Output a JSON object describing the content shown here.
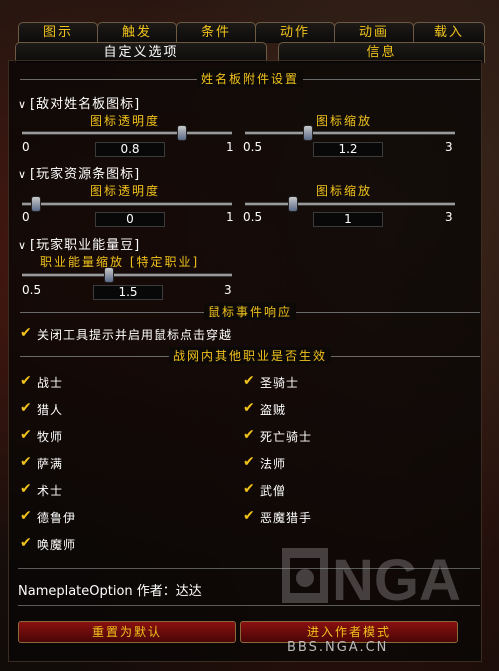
{
  "top_tabs": [
    "图示",
    "触发",
    "条件",
    "动作",
    "动画",
    "载入"
  ],
  "sub_tabs": [
    "自定义选项",
    "信息"
  ],
  "section_nameplate": "姓名板附件设置",
  "group1": {
    "title": "[敌对姓名板图标]",
    "slider_a": {
      "label": "图标透明度",
      "min": "0",
      "max": "1",
      "value": "0.8"
    },
    "slider_b": {
      "label": "图标缩放",
      "min": "0.5",
      "max": "3",
      "value": "1.2"
    }
  },
  "group2": {
    "title": "[玩家资源条图标]",
    "slider_a": {
      "label": "图标透明度",
      "min": "0",
      "max": "1",
      "value": "0"
    },
    "slider_b": {
      "label": "图标缩放",
      "min": "0.5",
      "max": "3",
      "value": "1"
    }
  },
  "group3": {
    "title": "[玩家职业能量豆]",
    "slider_a": {
      "label": "职业能量缩放 [特定职业]",
      "min": "0.5",
      "max": "3",
      "value": "1.5"
    }
  },
  "section_mouse": "鼠标事件响应",
  "mouse_option": "关闭工具提示并启用鼠标点击穿越",
  "section_classes": "战网内其他职业是否生效",
  "classes_left": [
    "战士",
    "猎人",
    "牧师",
    "萨满",
    "术士",
    "德鲁伊",
    "唤魔师"
  ],
  "classes_right": [
    "圣骑士",
    "盗贼",
    "死亡骑士",
    "法师",
    "武僧",
    "恶魔猎手"
  ],
  "author": "NameplateOption 作者：达达",
  "buttons": {
    "reset": "重置为默认",
    "author_mode": "进入作者模式"
  },
  "watermark": "BBS.NGA.CN"
}
